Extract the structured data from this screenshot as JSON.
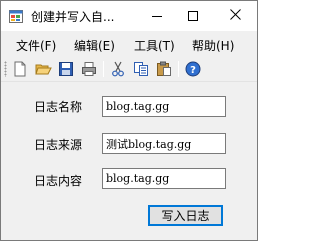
{
  "window": {
    "title": "创建并写入自...",
    "controls": {
      "minimize": "minimize",
      "maximize": "maximize",
      "close": "close"
    }
  },
  "menu": {
    "items": [
      {
        "label": "文件(F)"
      },
      {
        "label": "编辑(E)"
      },
      {
        "label": "工具(T)"
      },
      {
        "label": "帮助(H)"
      }
    ]
  },
  "toolbar": {
    "icons": [
      "new-icon",
      "open-icon",
      "save-icon",
      "print-icon",
      "cut-icon",
      "copy-icon",
      "paste-icon",
      "help-icon"
    ]
  },
  "form": {
    "log_name_label": "日志名称",
    "log_name_value": "blog.tag.gg",
    "log_source_label": "日志来源",
    "log_source_value": "测试blog.tag.gg",
    "log_content_label": "日志内容",
    "log_content_value": "blog.tag.gg",
    "submit_label": "写入日志"
  },
  "colors": {
    "window_bg": "#f0f0f0",
    "titlebar_bg": "#ffffff",
    "focus_border": "#0078d7",
    "textbox_border": "#7a7a7a"
  }
}
